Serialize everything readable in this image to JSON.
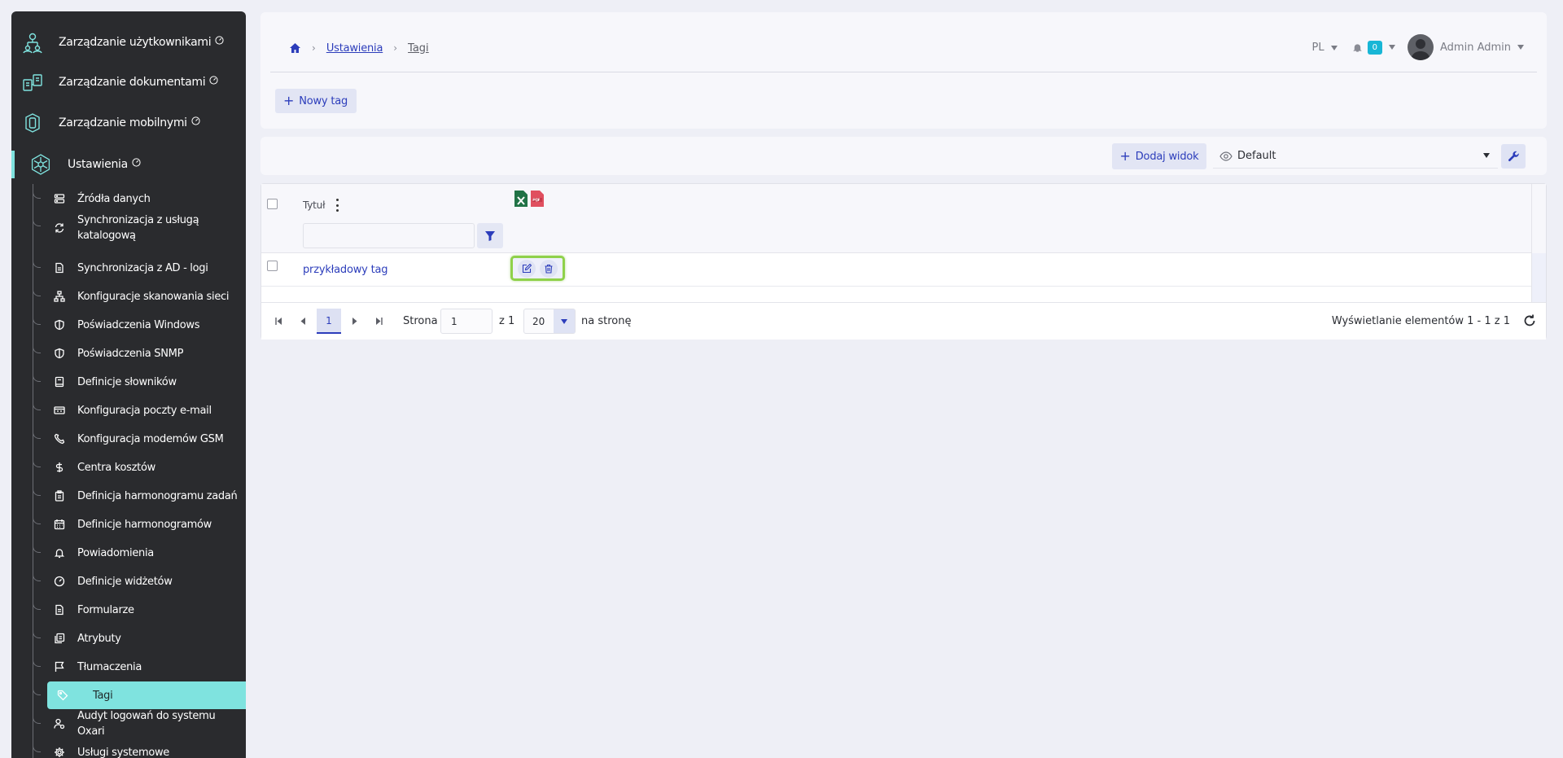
{
  "sidebar": {
    "top_items": [
      {
        "label": "Zarządzanie użytkownikami",
        "icon": "users-hierarchy-icon"
      },
      {
        "label": "Zarządzanie dokumentami",
        "icon": "documents-icon"
      },
      {
        "label": "Zarządzanie mobilnymi",
        "icon": "mobile-device-icon"
      },
      {
        "label": "Ustawienia",
        "icon": "settings-network-icon"
      }
    ],
    "sub_items": [
      {
        "label": "Źródła danych",
        "icon": "server-icon"
      },
      {
        "label": "Synchronizacja z usługą katalogową",
        "icon": "sync-icon"
      },
      {
        "label": "Synchronizacja z AD - logi",
        "icon": "document-icon"
      },
      {
        "label": "Konfiguracje skanowania sieci",
        "icon": "network-icon"
      },
      {
        "label": "Poświadczenia Windows",
        "icon": "shield-icon"
      },
      {
        "label": "Poświadczenia SNMP",
        "icon": "shield-icon"
      },
      {
        "label": "Definicje słowników",
        "icon": "book-icon"
      },
      {
        "label": "Konfiguracja poczty e-mail",
        "icon": "mail-icon"
      },
      {
        "label": "Konfiguracja modemów GSM",
        "icon": "phone-icon"
      },
      {
        "label": "Centra kosztów",
        "icon": "dollar-icon"
      },
      {
        "label": "Definicja harmonogramu zadań",
        "icon": "clipboard-icon"
      },
      {
        "label": "Definicje harmonogramów",
        "icon": "calendar-icon"
      },
      {
        "label": "Powiadomienia",
        "icon": "bell-icon"
      },
      {
        "label": "Definicje widżetów",
        "icon": "gauge-icon"
      },
      {
        "label": "Formularze",
        "icon": "form-icon"
      },
      {
        "label": "Atrybuty",
        "icon": "attributes-icon"
      },
      {
        "label": "Tłumaczenia",
        "icon": "flag-icon"
      },
      {
        "label": "Tagi",
        "icon": "tag-icon"
      },
      {
        "label": "Audyt logowań do systemu Oxari",
        "icon": "user-audit-icon"
      },
      {
        "label": "Usługi systemowe",
        "icon": "gear-icon"
      }
    ],
    "selected": "Tagi"
  },
  "header": {
    "breadcrumb": [
      "Ustawienia",
      "Tagi"
    ],
    "language": "PL",
    "notifications_count": "0",
    "user_name": "Admin Admin",
    "new_tag_label": "Nowy tag"
  },
  "view_bar": {
    "add_view_label": "Dodaj widok",
    "selected_view": "Default"
  },
  "grid": {
    "column_title": "Tytuł",
    "rows": [
      {
        "title": "przykładowy tag"
      }
    ]
  },
  "pager": {
    "current_page": "1",
    "page_label": "Strona",
    "page_input": "1",
    "of_label": "z 1",
    "page_size": "20",
    "per_page_label": "na stronę",
    "info": "Wyświetlanie elementów 1 - 1 z 1"
  },
  "colors": {
    "accent": "#2c3dbb",
    "sidebar_bg": "#2a2b2e",
    "selected_bg": "#7fe3df",
    "badge": "#18b6d6",
    "highlight": "#8fd14a"
  }
}
